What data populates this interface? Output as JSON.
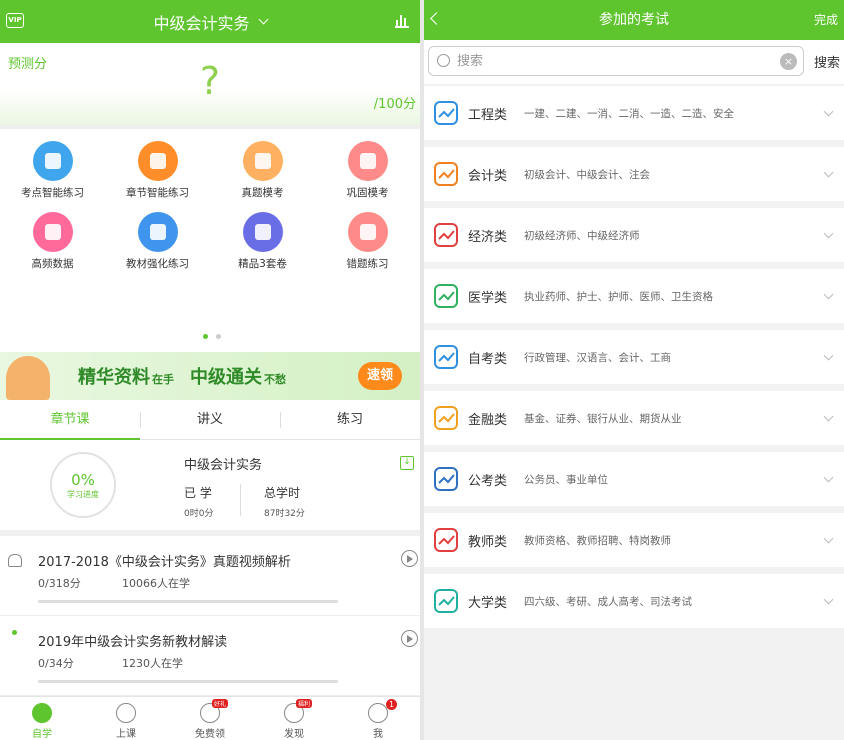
{
  "left": {
    "header": {
      "vip": "VIP",
      "title": "中级会计实务"
    },
    "score": {
      "label": "预测分",
      "value": "?",
      "total": "/100分"
    },
    "grid": [
      {
        "label": "考点智能练习",
        "color": "#3fa6ee"
      },
      {
        "label": "章节智能练习",
        "color": "#ff8d2a"
      },
      {
        "label": "真题模考",
        "color": "#ffb061"
      },
      {
        "label": "巩固模考",
        "color": "#ff8a8a"
      },
      {
        "label": "高频数据",
        "color": "#ff6a9a"
      },
      {
        "label": "教材强化练习",
        "color": "#3f95ee"
      },
      {
        "label": "精品3套卷",
        "color": "#6a6ee6"
      },
      {
        "label": "错题练习",
        "color": "#ff8a8a"
      }
    ],
    "banner": {
      "text1": "精华资料",
      "small1": "在手",
      "text2": "中级通关",
      "small2": "不愁",
      "button": "速领"
    },
    "tabs": [
      "章节课",
      "讲义",
      "练习"
    ],
    "course": {
      "progress": "0%",
      "progress_label": "学习进度",
      "name": "中级会计实务",
      "studied_label": "已 学",
      "studied_value": "0时0分",
      "total_label": "总学时",
      "total_value": "87时32分"
    },
    "lessons": [
      {
        "title": "2017-2018《中级会计实务》真题视频解析",
        "progress": "0/318分",
        "students": "10066人在学"
      },
      {
        "title": "2019年中级会计实务新教材解读",
        "progress": "0/34分",
        "students": "1230人在学"
      }
    ],
    "nav": [
      {
        "label": "自学"
      },
      {
        "label": "上课"
      },
      {
        "label": "免费领",
        "hot": "好礼"
      },
      {
        "label": "发现",
        "hot": "福利"
      },
      {
        "label": "我",
        "badge": "1"
      }
    ]
  },
  "right": {
    "header": {
      "title": "参加的考试",
      "done": "完成"
    },
    "search": {
      "placeholder": "搜索",
      "button": "搜索"
    },
    "categories": [
      {
        "name": "工程类",
        "desc": "一建、二建、一消、二消、一造、二造、安全",
        "color": "#2f8fe0"
      },
      {
        "name": "会计类",
        "desc": "初级会计、中级会计、注会",
        "color": "#f08020"
      },
      {
        "name": "经济类",
        "desc": "初级经济师、中级经济师",
        "color": "#e04040"
      },
      {
        "name": "医学类",
        "desc": "执业药师、护士、护师、医师、卫生资格",
        "color": "#30b060"
      },
      {
        "name": "自考类",
        "desc": "行政管理、汉语言、会计、工商",
        "color": "#3090e0"
      },
      {
        "name": "金融类",
        "desc": "基金、证券、银行从业、期货从业",
        "color": "#f0a020"
      },
      {
        "name": "公考类",
        "desc": "公务员、事业单位",
        "color": "#3070c0"
      },
      {
        "name": "教师类",
        "desc": "教师资格、教师招聘、特岗教师",
        "color": "#e04040"
      },
      {
        "name": "大学类",
        "desc": "四六级、考研、成人高考、司法考试",
        "color": "#20b0a0"
      }
    ]
  }
}
